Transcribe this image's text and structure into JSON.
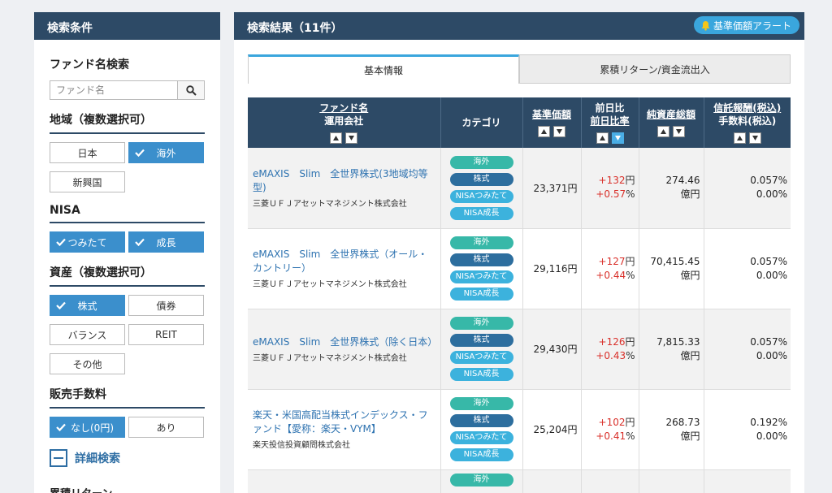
{
  "left": {
    "header": "検索条件",
    "fund_search": {
      "title": "ファンド名検索",
      "placeholder": "ファンド名"
    },
    "region": {
      "title": "地域（複数選択可）",
      "options": [
        {
          "label": "日本",
          "selected": false
        },
        {
          "label": "海外",
          "selected": true
        },
        {
          "label": "新興国",
          "selected": false
        }
      ]
    },
    "nisa": {
      "title": "NISA",
      "options": [
        {
          "label": "つみたて",
          "selected": true
        },
        {
          "label": "成長",
          "selected": true
        }
      ]
    },
    "asset": {
      "title": "資産（複数選択可）",
      "options": [
        {
          "label": "株式",
          "selected": true
        },
        {
          "label": "債券",
          "selected": false
        },
        {
          "label": "バランス",
          "selected": false
        },
        {
          "label": "REIT",
          "selected": false
        },
        {
          "label": "その他",
          "selected": false
        }
      ]
    },
    "fee": {
      "title": "販売手数料",
      "options": [
        {
          "label": "なし(0円)",
          "selected": true
        },
        {
          "label": "あり",
          "selected": false
        }
      ]
    },
    "detail_label": "詳細検索",
    "next_section": "累積リターン"
  },
  "right": {
    "title": "検索結果（11件）",
    "alert_label": "基準価額アラート",
    "tabs": [
      "基本情報",
      "累積リターン/資金流出入"
    ],
    "headers": {
      "name": "ファンド名",
      "company": "運用会社",
      "category": "カテゴリ",
      "nav": "基準価額",
      "change": "前日比",
      "change_rate": "前日比率",
      "assets": "純資産総額",
      "fee": "信託報酬(税込)",
      "fee2": "手数料(税込)"
    },
    "category_labels": {
      "kaigai": "海外",
      "kabu": "株式",
      "tsumitate": "NISAつみたて",
      "seicho": "NISA成長"
    },
    "rows": [
      {
        "name": "eMAXIS　Slim　全世界株式(3地域均等型)",
        "company": "三菱ＵＦＪアセットマネジメント株式会社",
        "nav": "23,371円",
        "change": "+132",
        "change_unit": "円",
        "rate": "+0.57",
        "rate_unit": "%",
        "assets": "274.46",
        "assets_unit": "億円",
        "fee": "0.057%",
        "fee2": "0.00%"
      },
      {
        "name": "eMAXIS　Slim　全世界株式（オール・カントリー）",
        "company": "三菱ＵＦＪアセットマネジメント株式会社",
        "nav": "29,116円",
        "change": "+127",
        "change_unit": "円",
        "rate": "+0.44",
        "rate_unit": "%",
        "assets": "70,415.45",
        "assets_unit": "億円",
        "fee": "0.057%",
        "fee2": "0.00%"
      },
      {
        "name": "eMAXIS　Slim　全世界株式（除く日本）",
        "company": "三菱ＵＦＪアセットマネジメント株式会社",
        "nav": "29,430円",
        "change": "+126",
        "change_unit": "円",
        "rate": "+0.43",
        "rate_unit": "%",
        "assets": "7,815.33",
        "assets_unit": "億円",
        "fee": "0.057%",
        "fee2": "0.00%"
      },
      {
        "name": "楽天・米国高配当株式インデックス・ファンド【愛称：楽天・VYM】",
        "company": "楽天投信投資顧問株式会社",
        "nav": "25,204円",
        "change": "+102",
        "change_unit": "円",
        "rate": "+0.41",
        "rate_unit": "%",
        "assets": "268.73",
        "assets_unit": "億円",
        "fee": "0.192%",
        "fee2": "0.00%"
      }
    ],
    "partial_row_pill": "海外"
  }
}
